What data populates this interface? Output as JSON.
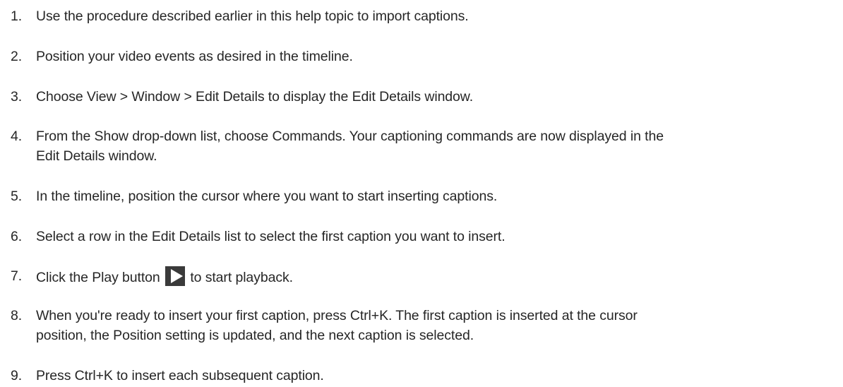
{
  "steps": [
    {
      "num": "1.",
      "text": "Use the procedure described earlier in this help topic to import captions."
    },
    {
      "num": "2.",
      "text": "Position your video events as desired in the timeline."
    },
    {
      "num": "3.",
      "text": "Choose View > Window > Edit Details to display the Edit Details window."
    },
    {
      "num": "4.",
      "line1": "From the Show drop-down list, choose Commands. Your captioning commands are now displayed in the",
      "line2": "Edit Details window."
    },
    {
      "num": "5.",
      "text": "In the timeline, position the cursor where you want to start inserting captions."
    },
    {
      "num": "6.",
      "text": "Select a row in the Edit Details list to select the first caption you want to insert."
    },
    {
      "num": "7.",
      "before": "Click the Play button",
      "after": "to start playback."
    },
    {
      "num": "8.",
      "line1": "When you're ready to insert your first caption, press Ctrl+K. The first caption is inserted at the cursor",
      "line2": "position, the Position setting is updated, and the next caption is selected."
    },
    {
      "num": "9.",
      "text": "Press Ctrl+K to insert each subsequent caption."
    }
  ],
  "icons": {
    "play": "play-icon",
    "play_bg": "#3a3a3a",
    "play_fg": "#ffffff"
  }
}
